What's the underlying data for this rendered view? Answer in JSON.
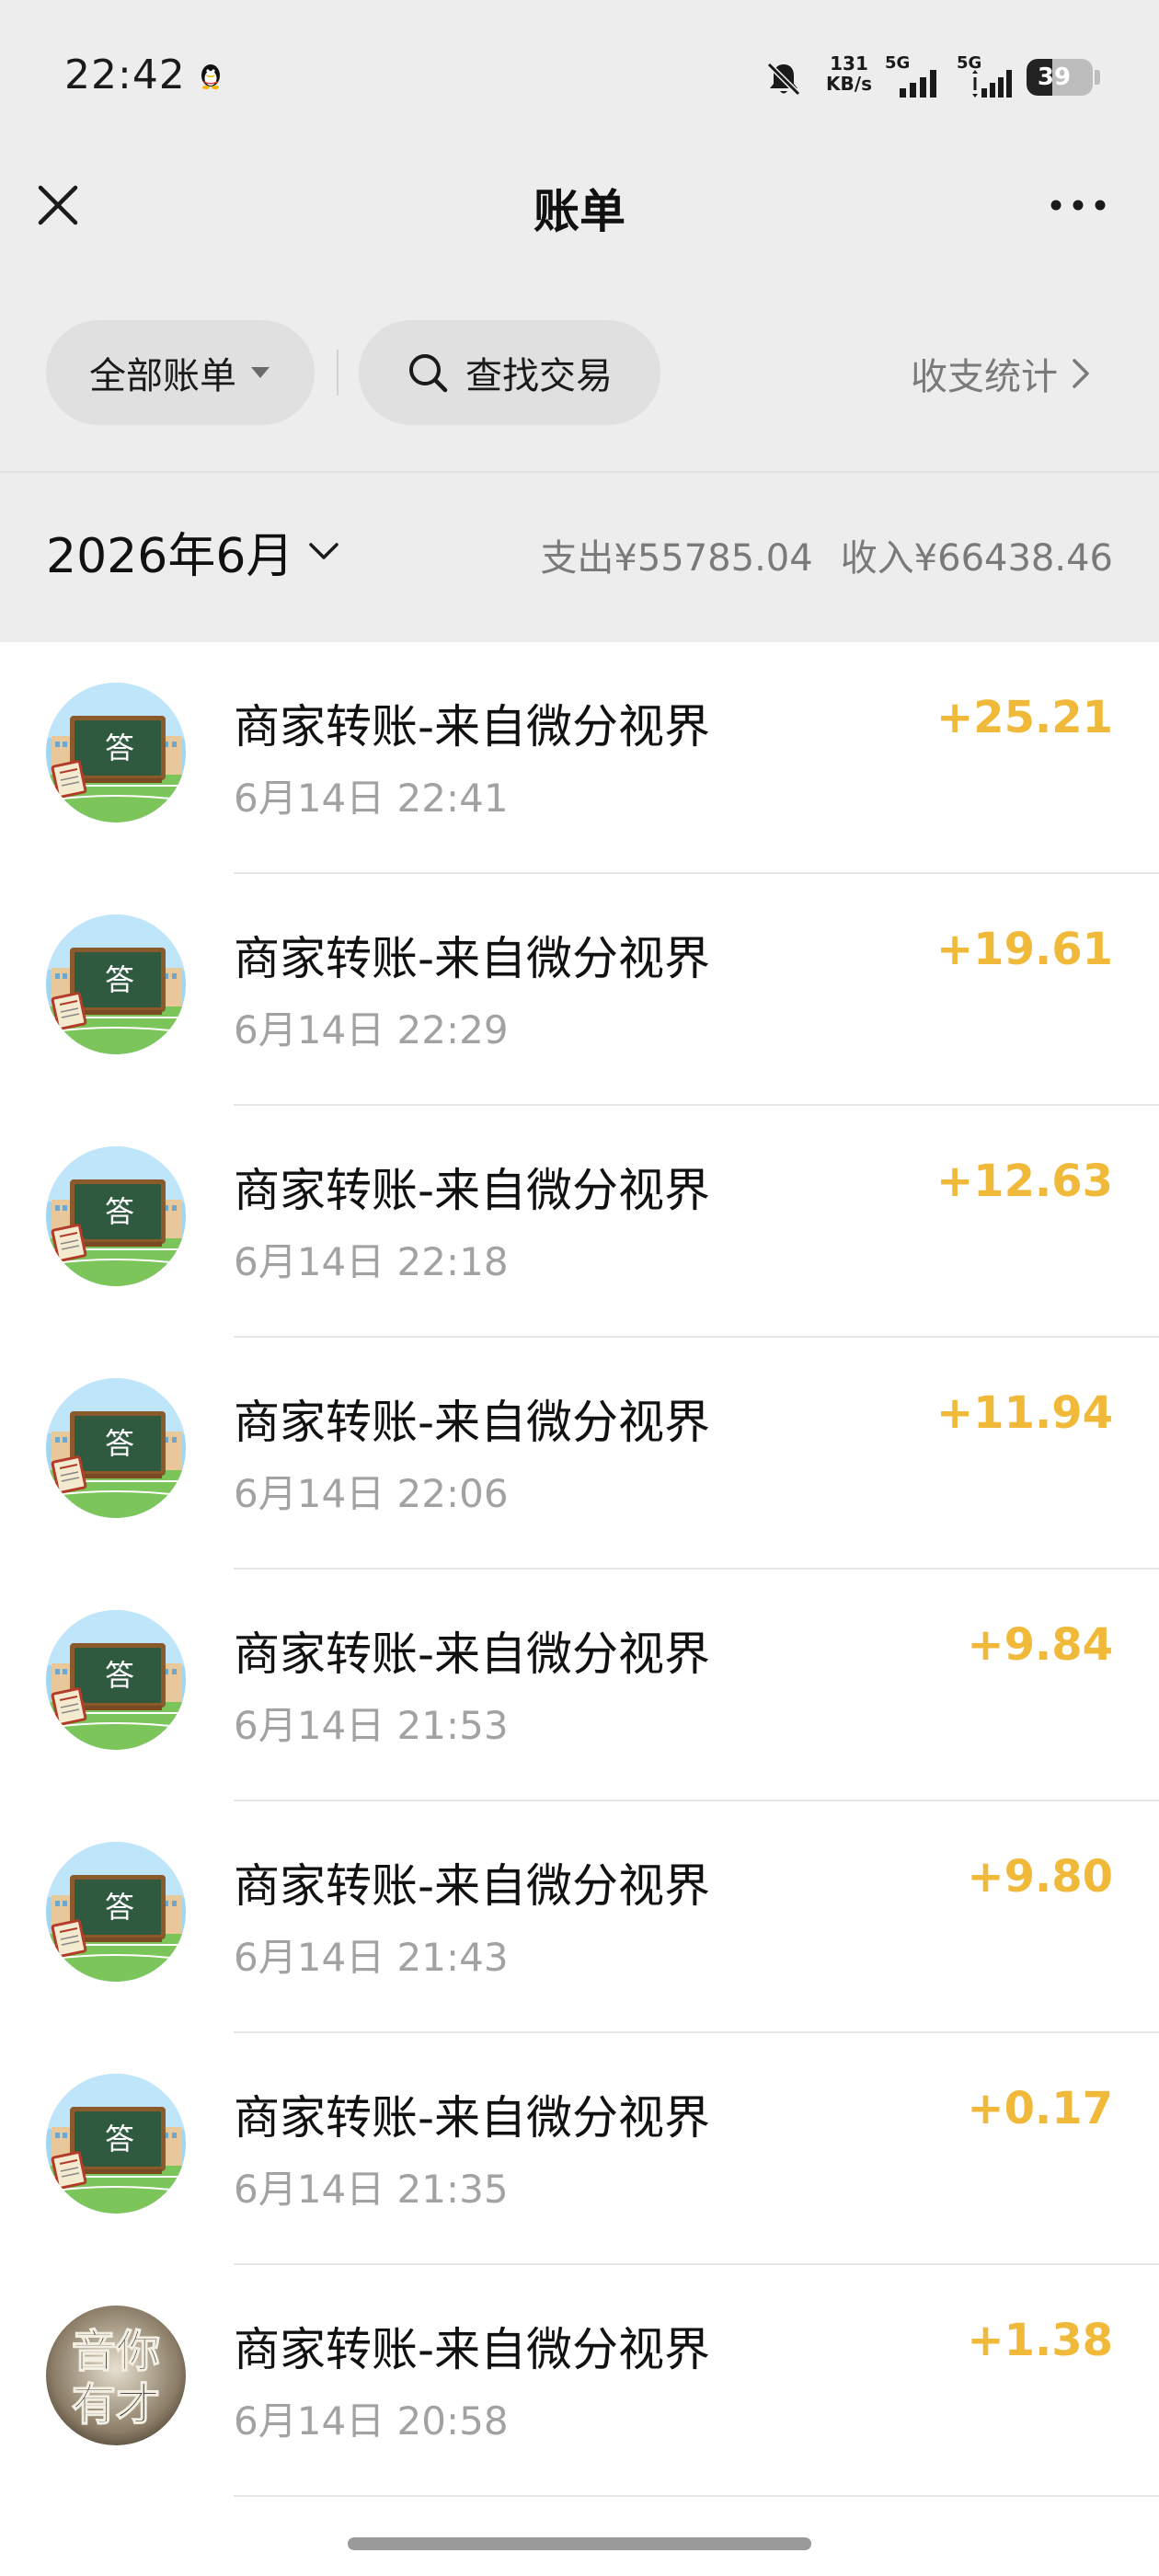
{
  "status_bar": {
    "time": "22:42",
    "net_speed_value": "131",
    "net_speed_unit": "KB/s",
    "sim1": "5G",
    "sim2": "5G",
    "battery": "39",
    "battery_level": 0.39
  },
  "nav": {
    "title": "账单"
  },
  "filters": {
    "all_bills": "全部账单",
    "search": "查找交易",
    "stats": "收支统计"
  },
  "month_summary": {
    "month": "2026年6月",
    "expense": "支出¥55785.04",
    "income": "收入¥66438.46"
  },
  "transactions": [
    {
      "title": "商家转账-来自微分视界",
      "date": "6月14日 22:41",
      "amount": "+25.21",
      "avatar": "chalkboard-answer"
    },
    {
      "title": "商家转账-来自微分视界",
      "date": "6月14日 22:29",
      "amount": "+19.61",
      "avatar": "chalkboard-answer"
    },
    {
      "title": "商家转账-来自微分视界",
      "date": "6月14日 22:18",
      "amount": "+12.63",
      "avatar": "chalkboard-answer"
    },
    {
      "title": "商家转账-来自微分视界",
      "date": "6月14日 22:06",
      "amount": "+11.94",
      "avatar": "chalkboard-answer"
    },
    {
      "title": "商家转账-来自微分视界",
      "date": "6月14日 21:53",
      "amount": "+9.84",
      "avatar": "chalkboard-answer"
    },
    {
      "title": "商家转账-来自微分视界",
      "date": "6月14日 21:43",
      "amount": "+9.80",
      "avatar": "chalkboard-answer"
    },
    {
      "title": "商家转账-来自微分视界",
      "date": "6月14日 21:35",
      "amount": "+0.17",
      "avatar": "chalkboard-answer"
    },
    {
      "title": "商家转账-来自微分视界",
      "date": "6月14日 20:58",
      "amount": "+1.38",
      "avatar": "music-talent"
    }
  ],
  "avatar_texts": {
    "board": "答",
    "music_line1": "音你",
    "music_line2": "有才"
  },
  "colors": {
    "top_background": "#ededed",
    "amount": "#f0b93a",
    "secondary_text": "#a2a2a2"
  }
}
